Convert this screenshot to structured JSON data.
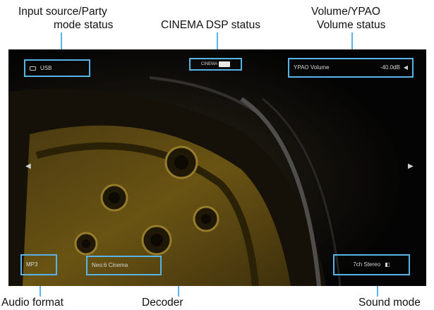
{
  "labels": {
    "input_source_line1": "Input source/Party",
    "input_source_line2": "mode status",
    "cinema_dsp": "CINEMA DSP status",
    "volume_line1": "Volume/YPAO",
    "volume_line2": "Volume status",
    "audio_format": "Audio format",
    "decoder": "Decoder",
    "sound_mode": "Sound mode"
  },
  "osd": {
    "input": "USB",
    "dsp": "CINEMA",
    "ypao": "YPAO Volume",
    "volume": "-40.0dB",
    "audio_format": "MP3",
    "decoder": "Neo:6 Cinema",
    "sound_mode": "7ch Stereo"
  },
  "colors": {
    "highlight": "#58b4e6",
    "screen_bg": "#050505",
    "label_text": "#111111"
  }
}
